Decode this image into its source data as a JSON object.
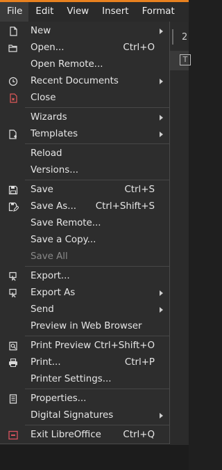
{
  "menubar": {
    "file": "File",
    "edit": "Edit",
    "view": "View",
    "insert": "Insert",
    "format": "Format"
  },
  "background": {
    "fragment": "2",
    "strip_letter": "T"
  },
  "file_menu": {
    "new": "New",
    "open": "Open...",
    "open_accel": "Ctrl+O",
    "open_remote": "Open Remote...",
    "recent_documents": "Recent Documents",
    "close": "Close",
    "wizards": "Wizards",
    "templates": "Templates",
    "reload": "Reload",
    "versions": "Versions...",
    "save": "Save",
    "save_accel": "Ctrl+S",
    "save_as": "Save As...",
    "save_as_accel": "Ctrl+Shift+S",
    "save_remote": "Save Remote...",
    "save_a_copy": "Save a Copy...",
    "save_all": "Save All",
    "export": "Export...",
    "export_as": "Export As",
    "send": "Send",
    "preview_in_web_browser": "Preview in Web Browser",
    "print_preview": "Print Preview",
    "print_preview_accel": "Ctrl+Shift+O",
    "print": "Print...",
    "print_accel": "Ctrl+P",
    "printer_settings": "Printer Settings...",
    "properties": "Properties...",
    "digital_signatures": "Digital Signatures",
    "exit": "Exit LibreOffice",
    "exit_accel": "Ctrl+Q"
  },
  "colors": {
    "accent": "#e8811f",
    "menu_bg": "#2d2d2d",
    "close_icon": "#e05a5a",
    "exit_icon": "#d9535f"
  }
}
